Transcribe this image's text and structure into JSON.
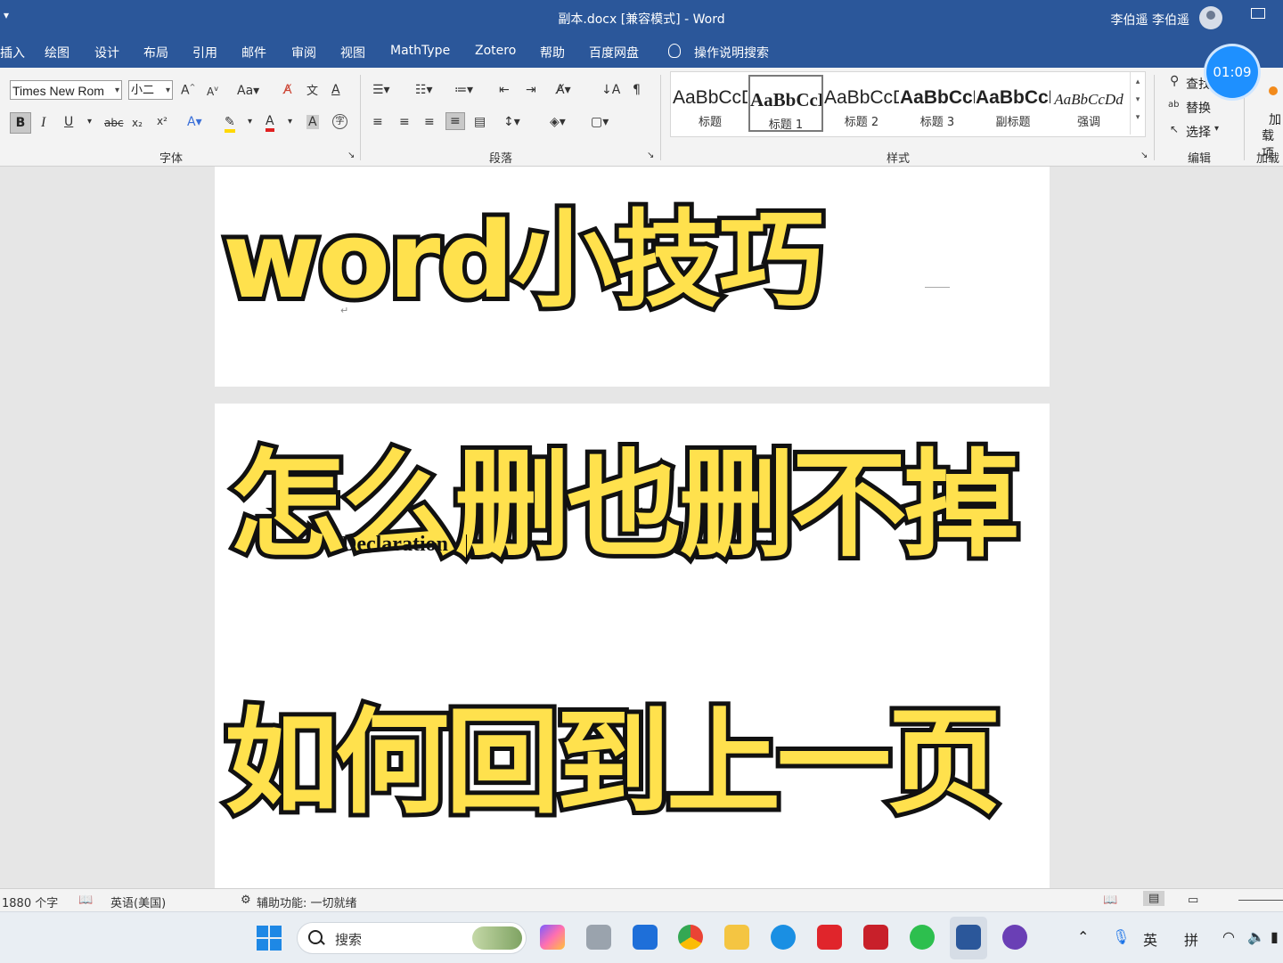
{
  "titlebar": {
    "qat_arrow": "▾",
    "title": "副本.docx [兼容模式]  -  Word",
    "user": "李伯遥 李伯遥"
  },
  "menu": {
    "tabs": [
      "插入",
      "绘图",
      "设计",
      "布局",
      "引用",
      "邮件",
      "审阅",
      "视图",
      "MathType",
      "Zotero",
      "帮助",
      "百度网盘"
    ],
    "tell_me": "操作说明搜索"
  },
  "timer": "01:09",
  "ribbon": {
    "font_name": "Times New Rom",
    "font_size": "小二",
    "group_font": "字体",
    "group_paragraph": "段落",
    "group_styles": "样式",
    "group_editing": "编辑",
    "group_addins": "加载",
    "styles": [
      {
        "preview": "AaBbCcDd",
        "name": "标题"
      },
      {
        "preview": "AaBbCcDd",
        "name": "标题 1"
      },
      {
        "preview": "AaBbCcDd",
        "name": "标题 2"
      },
      {
        "preview": "AaBbCcDd",
        "name": "标题 3"
      },
      {
        "preview": "AaBbCcDd",
        "name": "副标题"
      },
      {
        "preview": "AaBbCcDd",
        "name": "强调"
      }
    ],
    "edit_find": "查找",
    "edit_replace": "替换",
    "edit_select": "选择",
    "addin_1": "加",
    "addin_2": "载项"
  },
  "document": {
    "body_text": "Declaration"
  },
  "overlay": {
    "line1": "word小技巧",
    "line2": "怎么删也删不掉",
    "line3": "如何回到上一页"
  },
  "status": {
    "word_count": "1880 个字",
    "language": "英语(美国)",
    "accessibility": "辅助功能: 一切就绪"
  },
  "taskbar": {
    "search_label": "搜索",
    "ime_lang": "英",
    "ime_mode": "拼"
  },
  "colors": {
    "word_blue": "#2b579a",
    "overlay_yellow": "#ffe14d",
    "timer_blue": "#1e90ff"
  }
}
